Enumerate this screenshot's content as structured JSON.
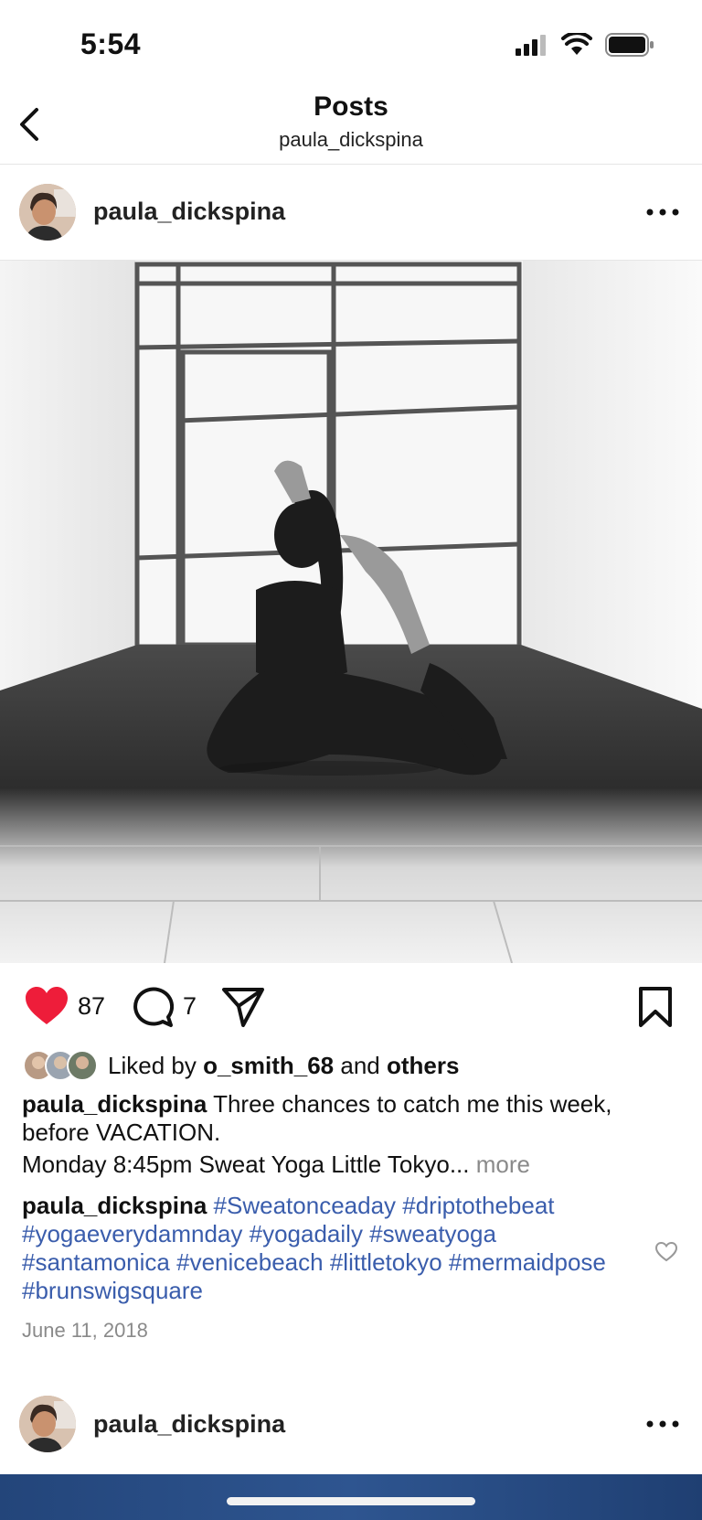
{
  "status_bar": {
    "time": "5:54"
  },
  "nav": {
    "title": "Posts",
    "subtitle": "paula_dickspina"
  },
  "post": {
    "username": "paula_dickspina",
    "likes": "87",
    "comments": "7",
    "liked_by_prefix": "Liked by ",
    "liked_by_user": "o_smith_68",
    "liked_by_mid": " and ",
    "liked_by_suffix": "others",
    "caption_user": "paula_dickspina",
    "caption_text": " Three chances to catch me this week, before VACATION.",
    "caption_line2": "Monday 8:45pm Sweat Yoga Little Tokyo...",
    "more_label": " more",
    "comment_user": "paula_dickspina",
    "hashtags": [
      "#Sweatonceaday",
      "#driptothebeat",
      "#yogaeverydamnday",
      "#yogadaily",
      "#sweatyoga",
      "#santamonica",
      "#venicebeach",
      "#littletokyo",
      "#mermaidpose",
      "#brunswigsquare"
    ],
    "date": "June 11, 2018"
  },
  "next_post": {
    "username": "paula_dickspina"
  },
  "colors": {
    "like_red": "#ee1d3a",
    "hashtag_blue": "#3a5dac",
    "muted": "#8a8a8a"
  },
  "icons": [
    "back-chevron-icon",
    "more-icon",
    "heart-icon",
    "comment-icon",
    "share-icon",
    "bookmark-icon",
    "comment-like-icon"
  ]
}
